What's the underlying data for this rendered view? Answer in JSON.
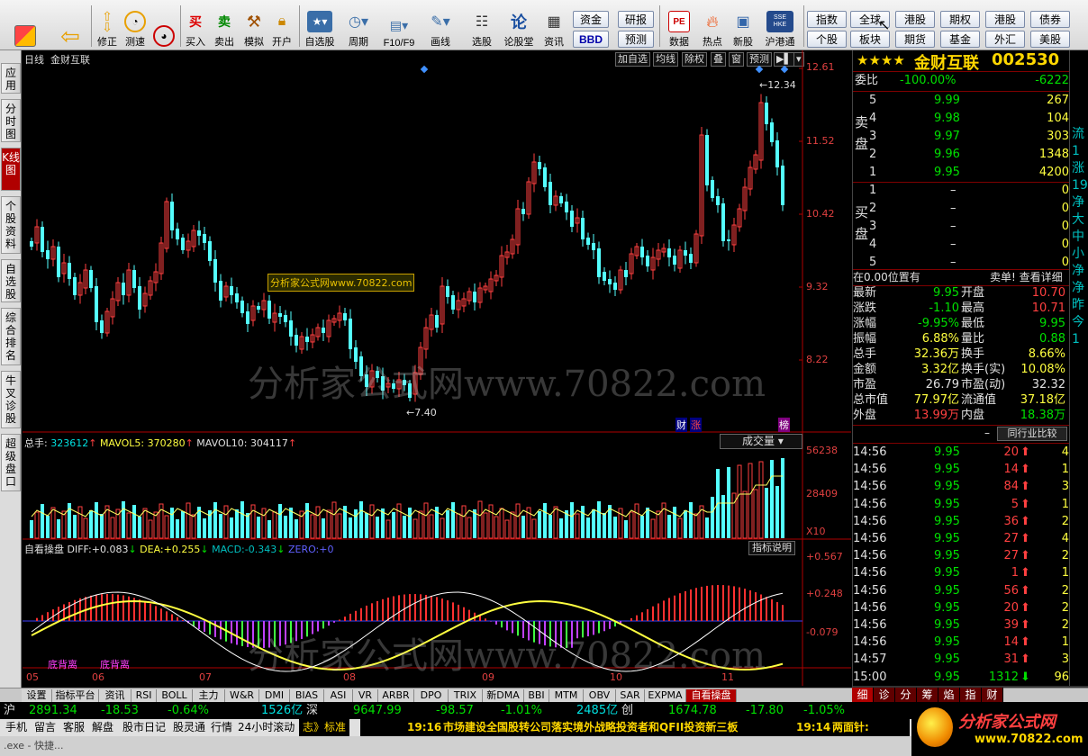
{
  "toolbar": {
    "buttons": [
      {
        "label": "",
        "icon": "home-grid-icon"
      },
      {
        "label": "",
        "icon": "back-arrow-icon"
      },
      {
        "label": "修正",
        "icon": "up-down-arrows-icon"
      },
      {
        "label": "测速",
        "icon": "clock-icon"
      },
      {
        "label": "买入",
        "icon": "buy-icon",
        "glyph": "买"
      },
      {
        "label": "卖出",
        "icon": "sell-icon",
        "glyph": "卖"
      },
      {
        "label": "模拟",
        "icon": "hammer-icon"
      },
      {
        "label": "开户",
        "icon": "lock-icon"
      },
      {
        "label": "自选股",
        "icon": "star-folder-icon"
      },
      {
        "label": "周期",
        "icon": "clock-period-icon"
      },
      {
        "label": "F10/F9",
        "icon": "f10-icon"
      },
      {
        "label": "画线",
        "icon": "pencil-icon"
      },
      {
        "label": "选股",
        "icon": "stock-pick-icon"
      },
      {
        "label": "论股堂",
        "icon": "forum-icon",
        "glyph": "论"
      },
      {
        "label": "资讯",
        "icon": "news-icon"
      },
      {
        "label": "数据",
        "icon": "pe-data-icon",
        "glyph": "PE"
      },
      {
        "label": "热点",
        "icon": "fire-icon"
      },
      {
        "label": "新股",
        "icon": "new-stock-icon"
      },
      {
        "label": "沪港通",
        "icon": "sse-hke-icon",
        "glyph": "SSE HKE"
      }
    ],
    "mid_buttons": [
      "资金",
      "研报",
      "BBD",
      "预测"
    ],
    "right_buttons_row1": [
      "指数",
      "全球",
      "港股",
      "期权",
      "港股",
      "债券"
    ],
    "right_buttons_row2": [
      "个股",
      "板块",
      "期货",
      "基金",
      "外汇",
      "美股"
    ]
  },
  "left_tabs": [
    "应用",
    "分时图",
    "K线图",
    "个股资料",
    "自选股",
    "综合排名",
    "牛叉诊股",
    "超级盘口"
  ],
  "chart": {
    "period": "日线",
    "stock_name": "金财互联",
    "header_buttons": [
      "加自选",
      "均线",
      "除权",
      "叠",
      "窗",
      "预测"
    ],
    "price_axis": [
      "12.61",
      "11.52",
      "10.42",
      "9.32",
      "8.22"
    ],
    "high_label": "12.34",
    "low_label": "7.40",
    "watermark_box": "分析家公式网www.70822.com",
    "watermark_big": "分析家公式网www.70822.com",
    "markers": [
      "财",
      "涨",
      "榜"
    ],
    "volume": {
      "label_total": "总手:",
      "total": "323612",
      "mavol5_label": "MAVOL5:",
      "mavol5": "370280",
      "mavol10_label": "MAVOL10:",
      "mavol10": "304117",
      "selector": "成交量",
      "axis": [
        "56238",
        "28409"
      ],
      "unit": "X10"
    },
    "macd": {
      "name": "自看操盘",
      "diff_label": "DIFF:",
      "diff": "+0.083",
      "dea_label": "DEA:",
      "dea": "+0.255",
      "macd_label": "MACD:",
      "macd": "-0.343",
      "zero_label": "ZERO:",
      "zero": "+0",
      "explain": "指标说明",
      "axis": [
        "+0.567",
        "+0.248",
        "-0.079"
      ],
      "labels": [
        "底背离",
        "底背离"
      ]
    },
    "months": [
      "05",
      "06",
      "07",
      "08",
      "09",
      "10",
      "11"
    ]
  },
  "quote": {
    "stars": "★★★★",
    "name": "金财互联",
    "code": "002530",
    "weibi_label": "委比",
    "weibi": "-100.00%",
    "weicha": "-6222",
    "sell_label": [
      "卖",
      "盘"
    ],
    "sells": [
      {
        "lvl": "5",
        "price": "9.99",
        "vol": "267"
      },
      {
        "lvl": "4",
        "price": "9.98",
        "vol": "104"
      },
      {
        "lvl": "3",
        "price": "9.97",
        "vol": "303"
      },
      {
        "lvl": "2",
        "price": "9.96",
        "vol": "1348"
      },
      {
        "lvl": "1",
        "price": "9.95",
        "vol": "4200"
      }
    ],
    "buy_label": [
      "买",
      "盘"
    ],
    "buys": [
      {
        "lvl": "1",
        "price": "–",
        "vol": "0"
      },
      {
        "lvl": "2",
        "price": "–",
        "vol": "0"
      },
      {
        "lvl": "3",
        "price": "–",
        "vol": "0"
      },
      {
        "lvl": "4",
        "price": "–",
        "vol": "0"
      },
      {
        "lvl": "5",
        "price": "–",
        "vol": "0"
      }
    ],
    "position_text": "在0.00位置有",
    "sell_detail": "卖单! 查看详细",
    "stats": [
      {
        "l1": "最新",
        "v1": "9.95",
        "c1": "green",
        "l2": "开盘",
        "v2": "10.70",
        "c2": "red"
      },
      {
        "l1": "涨跌",
        "v1": "-1.10",
        "c1": "green",
        "l2": "最高",
        "v2": "10.71",
        "c2": "red"
      },
      {
        "l1": "涨幅",
        "v1": "-9.95%",
        "c1": "green",
        "l2": "最低",
        "v2": "9.95",
        "c2": "green"
      },
      {
        "l1": "振幅",
        "v1": "6.88%",
        "c1": "yellow",
        "l2": "量比",
        "v2": "0.88",
        "c2": "green"
      },
      {
        "l1": "总手",
        "v1": "32.36万",
        "c1": "yellow",
        "l2": "换手",
        "v2": "8.66%",
        "c2": "yellow"
      },
      {
        "l1": "金额",
        "v1": "3.32亿",
        "c1": "yellow",
        "l2": "换手(实)",
        "v2": "10.08%",
        "c2": "yellow"
      },
      {
        "l1": "市盈",
        "v1": "26.79",
        "c1": "white",
        "l2": "市盈(动)",
        "v2": "32.32",
        "c2": "white"
      },
      {
        "l1": "总市值",
        "v1": "77.97亿",
        "c1": "yellow",
        "l2": "流通值",
        "v2": "37.18亿",
        "c2": "yellow"
      },
      {
        "l1": "外盘",
        "v1": "13.99万",
        "c1": "red",
        "l2": "内盘",
        "v2": "18.38万",
        "c2": "green"
      }
    ],
    "peer_btn": "同行业比较",
    "ticks": [
      {
        "t": "14:56",
        "p": "9.95",
        "v": "20",
        "d": "up",
        "n": "4"
      },
      {
        "t": "14:56",
        "p": "9.95",
        "v": "14",
        "d": "up",
        "n": "1"
      },
      {
        "t": "14:56",
        "p": "9.95",
        "v": "84",
        "d": "up",
        "n": "3"
      },
      {
        "t": "14:56",
        "p": "9.95",
        "v": "5",
        "d": "up",
        "n": "1"
      },
      {
        "t": "14:56",
        "p": "9.95",
        "v": "36",
        "d": "up",
        "n": "2"
      },
      {
        "t": "14:56",
        "p": "9.95",
        "v": "27",
        "d": "up",
        "n": "4"
      },
      {
        "t": "14:56",
        "p": "9.95",
        "v": "27",
        "d": "up",
        "n": "2"
      },
      {
        "t": "14:56",
        "p": "9.95",
        "v": "1",
        "d": "up",
        "n": "1"
      },
      {
        "t": "14:56",
        "p": "9.95",
        "v": "56",
        "d": "up",
        "n": "2"
      },
      {
        "t": "14:56",
        "p": "9.95",
        "v": "20",
        "d": "up",
        "n": "2"
      },
      {
        "t": "14:56",
        "p": "9.95",
        "v": "39",
        "d": "up",
        "n": "2"
      },
      {
        "t": "14:56",
        "p": "9.95",
        "v": "14",
        "d": "up",
        "n": "1"
      },
      {
        "t": "14:57",
        "p": "9.95",
        "v": "31",
        "d": "up",
        "n": "3"
      },
      {
        "t": "15:00",
        "p": "9.95",
        "v": "1312",
        "d": "down",
        "n": "96"
      }
    ],
    "bottom_tabs": [
      "细",
      "诊",
      "分",
      "筹",
      "焰",
      "指",
      "财"
    ]
  },
  "bottom_tabs": [
    "设置",
    "指标平台",
    "资讯",
    "RSI",
    "BOLL",
    "主力",
    "W&R",
    "DMI",
    "BIAS",
    "ASI",
    "VR",
    "ARBR",
    "DPO",
    "TRIX",
    "新DMA",
    "BBI",
    "MTM",
    "OBV",
    "SAR",
    "EXPMA",
    "自看操盘"
  ],
  "index_bar": {
    "sh_label": "沪",
    "sh_val": "2891.34",
    "sh_chg": "-18.53",
    "sh_pct": "-0.64%",
    "sh_amt": "1526亿",
    "sz_label": "深",
    "sz_val": "9647.99",
    "sz_chg": "-98.57",
    "sz_pct": "-1.01%",
    "sz_amt": "2485亿",
    "cy_label": "创",
    "cy_val": "1674.78",
    "cy_chg": "-17.80",
    "cy_pct": "-1.05%"
  },
  "status_bar": {
    "items": [
      "手机",
      "留言",
      "客服",
      "解盘",
      "股市日记",
      "股灵通",
      "行情",
      "24小时滚动"
    ],
    "news_label": "志》标准",
    "news_time": "19:16",
    "news": "市场建设全国股转公司落实境外战略投资者和QFII投资新三板",
    "time2": "19:14",
    "two_market": "两面针:",
    "logo": "分析家公式网",
    "logo_url": "www.70822.com"
  }
}
